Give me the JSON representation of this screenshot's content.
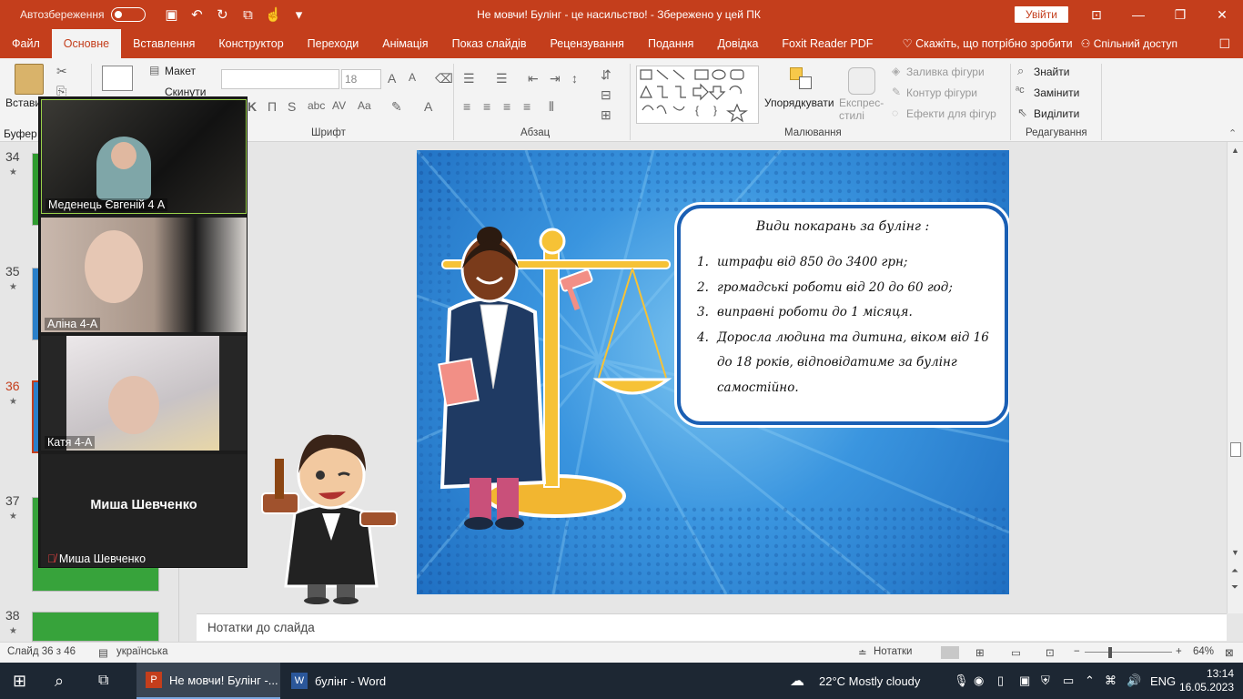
{
  "titlebar": {
    "autosave_label": "Автозбереження",
    "doc_title": "Не мовчи! Булінг - це насильство!  -  Збережено у цей ПК",
    "signin": "Увійти"
  },
  "tabs": [
    "Файл",
    "Основне",
    "Вставлення",
    "Конструктор",
    "Переходи",
    "Анімація",
    "Показ слайдів",
    "Рецензування",
    "Подання",
    "Довідка",
    "Foxit Reader PDF"
  ],
  "tellme": "Скажіть, що потрібно зробити",
  "share": "Спільний доступ",
  "ribbon": {
    "paste": "Встави",
    "clipboard": "Буфер о",
    "layout": "Макет",
    "reset": "Скинути",
    "font_size": "18",
    "font_group": "Шрифт",
    "paragraph_group": "Абзац",
    "drawing_group": "Малювання",
    "arrange": "Упорядкувати",
    "quick_styles": "Експрес-стилі",
    "shape_fill": "Заливка фігури",
    "shape_outline": "Контур фігури",
    "shape_effects": "Ефекти для фігур",
    "find": "Знайти",
    "replace": "Замінити",
    "select": "Виділити",
    "editing_group": "Редагування"
  },
  "thumbnails": [
    {
      "num": "34",
      "color": "#2f9b2f"
    },
    {
      "num": "35",
      "color": "#2a7fc9"
    },
    {
      "num": "36",
      "color": "#2a7fc9"
    },
    {
      "num": "37",
      "color": "#37a33b"
    },
    {
      "num": "38",
      "color": "#37a33b"
    }
  ],
  "zoom": {
    "participants": [
      "Меденець Євгеній 4 А",
      "Аліна 4-А",
      "Катя  4-А"
    ],
    "center_name": "Миша Шевченко",
    "footer_name": "Миша Шевченко"
  },
  "slide": {
    "title": "Види покарань за булінг :",
    "items": [
      {
        "n": "1.",
        "text": "штрафи від 850 до 3400 грн;"
      },
      {
        "n": "2.",
        "text": "громадські роботи від 20 до 60 год;"
      },
      {
        "n": "3.",
        "text": "виправні роботи до 1 місяця."
      },
      {
        "n": "4.",
        "text": "Доросла людина та дитина, віком від 16 до 18 років, відповідатиме за булінг самостійно."
      }
    ],
    "colors": {
      "callout_border": "#1a5fb4",
      "background": "#2f86d6"
    }
  },
  "notes_placeholder": "Нотатки до слайда",
  "status": {
    "slide_info": "Слайд 36 з 46",
    "language": "українська",
    "notes": "Нотатки",
    "zoom": "64%"
  },
  "taskbar": {
    "app1": "Не мовчи! Булінг -...",
    "app2": "булінг - Word",
    "weather": "22°C  Mostly cloudy",
    "lang": "ENG",
    "time": "13:14",
    "date": "16.05.2023"
  },
  "accent": "#c43e1c"
}
